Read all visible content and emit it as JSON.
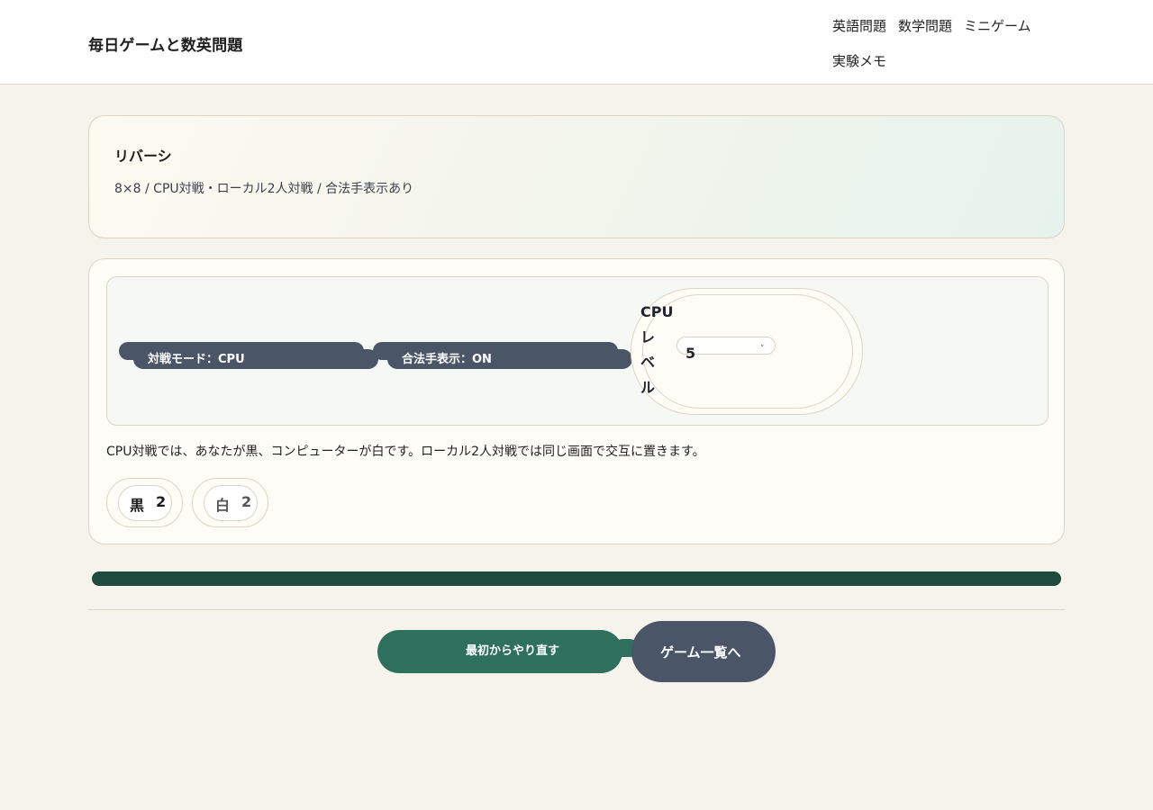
{
  "header": {
    "site_title": "毎日ゲームと数英問題",
    "nav": [
      "英語問題",
      "数学問題",
      "ミニゲーム",
      "実験メモ"
    ]
  },
  "hero": {
    "title": "リバーシ",
    "subtitle": "8×8 / CPU対戦・ローカル2人対戦 / 合法手表示あり"
  },
  "controls": {
    "mode_button": "対戦モード：CPU",
    "hints_button": "合法手表示：ON",
    "cpu_level_label": "CPU レ ベ ル",
    "cpu_level_value": "5",
    "caret": "˅"
  },
  "note": "CPU対戦では、あなたが黒、コンピューターが白です。ローカル2人対戦では同じ画面で交互に置きます。",
  "scores": {
    "black_label": "黒",
    "black_value": "2",
    "white_label": "白",
    "white_value": "2"
  },
  "actions": {
    "restart": "最初からやり直す",
    "game_list": "ゲーム一覧へ"
  },
  "colors": {
    "page_bg": "#f6f3ec",
    "accent_green": "#2e6f5e",
    "board_green": "#1f4a3e",
    "slate_button": "#4a5568"
  }
}
